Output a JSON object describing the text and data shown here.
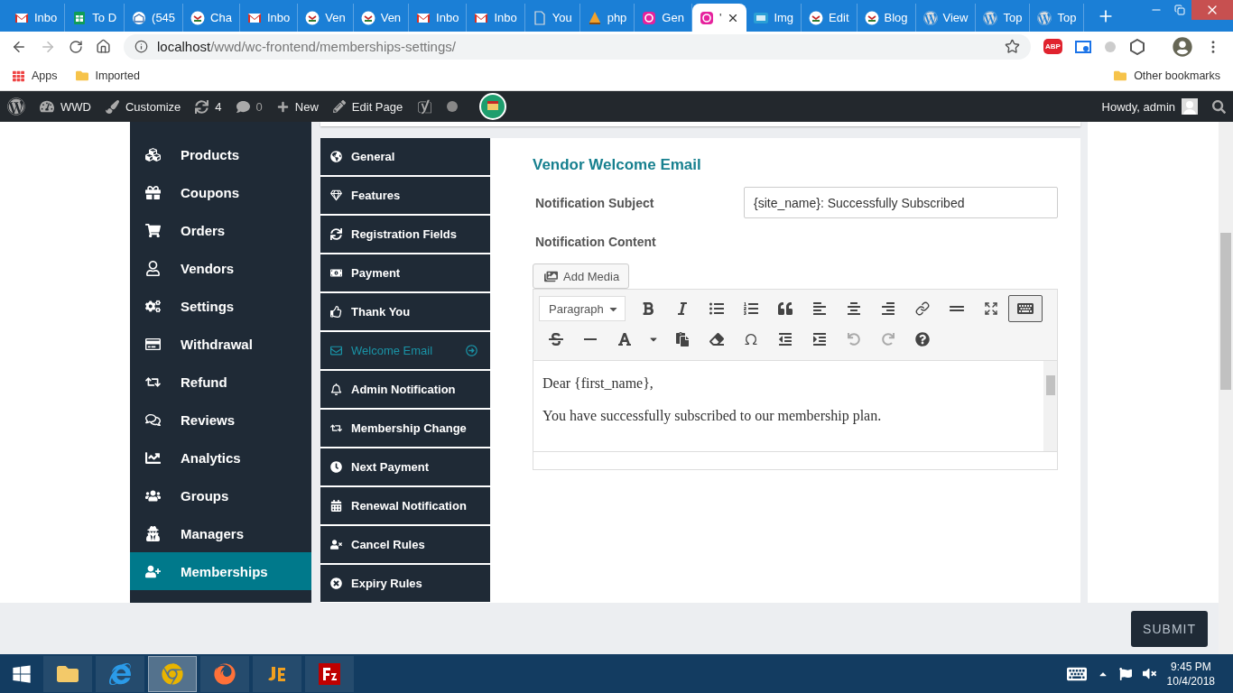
{
  "browser": {
    "tabs": [
      {
        "title": "Inbo",
        "selected": false
      },
      {
        "title": "To D",
        "selected": false
      },
      {
        "title": "(545",
        "selected": false
      },
      {
        "title": "Cha",
        "selected": false
      },
      {
        "title": "Inbo",
        "selected": false
      },
      {
        "title": "Ven",
        "selected": false
      },
      {
        "title": "Ven",
        "selected": false
      },
      {
        "title": "Inbo",
        "selected": false
      },
      {
        "title": "Inbo",
        "selected": false
      },
      {
        "title": "You",
        "selected": false
      },
      {
        "title": "php",
        "selected": false
      },
      {
        "title": "Gen",
        "selected": false
      },
      {
        "title": "'",
        "selected": true
      },
      {
        "title": "Img",
        "selected": false
      },
      {
        "title": "Edit",
        "selected": false
      },
      {
        "title": "Blog",
        "selected": false
      },
      {
        "title": "View",
        "selected": false
      },
      {
        "title": "Top",
        "selected": false
      },
      {
        "title": "Top",
        "selected": false
      }
    ],
    "url_host": "localhost",
    "url_path": "/wwd/wc-frontend/memberships-settings/",
    "extension_label": "ABP",
    "bookmarks": [
      "Apps",
      "Imported"
    ],
    "other_bookmarks": "Other bookmarks"
  },
  "admin_bar": {
    "site": "WWD",
    "customize": "Customize",
    "updates": "4",
    "comments": "0",
    "new": "New",
    "edit": "Edit Page",
    "greeting": "Howdy, admin"
  },
  "sidebar": {
    "items": [
      {
        "label": "Products",
        "selected": false
      },
      {
        "label": "Coupons",
        "selected": false
      },
      {
        "label": "Orders",
        "selected": false
      },
      {
        "label": "Vendors",
        "selected": false
      },
      {
        "label": "Settings",
        "selected": false
      },
      {
        "label": "Withdrawal",
        "selected": false
      },
      {
        "label": "Refund",
        "selected": false
      },
      {
        "label": "Reviews",
        "selected": false
      },
      {
        "label": "Analytics",
        "selected": false
      },
      {
        "label": "Groups",
        "selected": false
      },
      {
        "label": "Managers",
        "selected": false
      },
      {
        "label": "Memberships",
        "selected": true
      }
    ]
  },
  "settings_menu": {
    "items": [
      {
        "label": "General",
        "selected": false
      },
      {
        "label": "Features",
        "selected": false
      },
      {
        "label": "Registration Fields",
        "selected": false
      },
      {
        "label": "Payment",
        "selected": false
      },
      {
        "label": "Thank You",
        "selected": false
      },
      {
        "label": "Welcome Email",
        "selected": true
      },
      {
        "label": "Admin Notification",
        "selected": false
      },
      {
        "label": "Membership Change",
        "selected": false
      },
      {
        "label": "Next Payment",
        "selected": false
      },
      {
        "label": "Renewal Notification",
        "selected": false
      },
      {
        "label": "Cancel Rules",
        "selected": false
      },
      {
        "label": "Expiry Rules",
        "selected": false
      }
    ]
  },
  "form": {
    "title": "Vendor Welcome Email",
    "subject_label": "Notification Subject",
    "subject_value": "{site_name}: Successfully Subscribed",
    "content_label": "Notification Content",
    "add_media": "Add Media",
    "format": "Paragraph",
    "toolbar_toggle_pressed": true,
    "undo_disabled": true,
    "redo_disabled": true,
    "paragraphs": [
      "Dear {first_name},",
      "You have successfully subscribed to our membership plan."
    ]
  },
  "submit": "SUBMIT",
  "taskbar": {
    "apps": [
      {
        "selected": false
      },
      {
        "selected": false
      },
      {
        "selected": true
      },
      {
        "selected": false
      },
      {
        "selected": false
      },
      {
        "selected": false
      }
    ],
    "time": "9:45 PM",
    "date": "10/4/2018"
  }
}
